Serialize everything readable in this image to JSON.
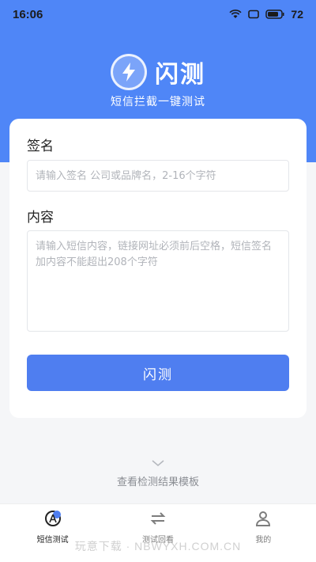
{
  "status_bar": {
    "time": "16:06",
    "battery": "72"
  },
  "brand": {
    "name": "闪测",
    "tagline": "短信拦截一键测试"
  },
  "form": {
    "sign_label": "签名",
    "sign_placeholder": "请输入签名 公司或品牌名，2-16个字符",
    "sign_value": "",
    "content_label": "内容",
    "content_placeholder": "请输入短信内容，链接网址必须前后空格，短信签名加内容不能超出208个字符",
    "content_value": "",
    "submit_label": "闪测"
  },
  "template_link": "查看检测结果模板",
  "tabs": [
    {
      "label": "短信测试",
      "icon": "sms-test-icon",
      "active": true
    },
    {
      "label": "测试回看",
      "icon": "history-icon",
      "active": false
    },
    {
      "label": "我的",
      "icon": "profile-icon",
      "active": false
    }
  ],
  "watermark": "玩意下载 · NBWYXH.COM.CN",
  "colors": {
    "primary": "#4f7ef0",
    "hero": "#4f86f7",
    "background": "#f5f6f8"
  }
}
